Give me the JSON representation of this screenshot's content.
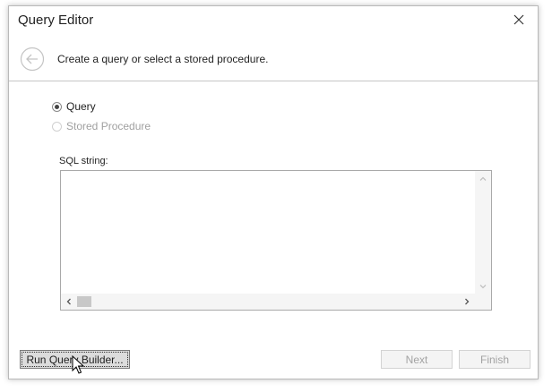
{
  "window": {
    "title": "Query Editor"
  },
  "header": {
    "instruction": "Create a query or select a stored procedure."
  },
  "options": {
    "query_label": "Query",
    "stored_procedure_label": "Stored Procedure",
    "selected": "Query"
  },
  "sql": {
    "label": "SQL string:",
    "value": ""
  },
  "buttons": {
    "run_query_builder": "Run Query Builder...",
    "next": "Next",
    "finish": "Finish"
  },
  "icons": {
    "close": "close-icon",
    "back": "back-arrow-icon",
    "scroll_up": "chevron-up-icon",
    "scroll_down": "chevron-down-icon",
    "scroll_left": "chevron-left-icon",
    "scroll_right": "chevron-right-icon"
  },
  "colors": {
    "disabled_text": "#a3a3a3",
    "border": "#a9a9a9"
  }
}
